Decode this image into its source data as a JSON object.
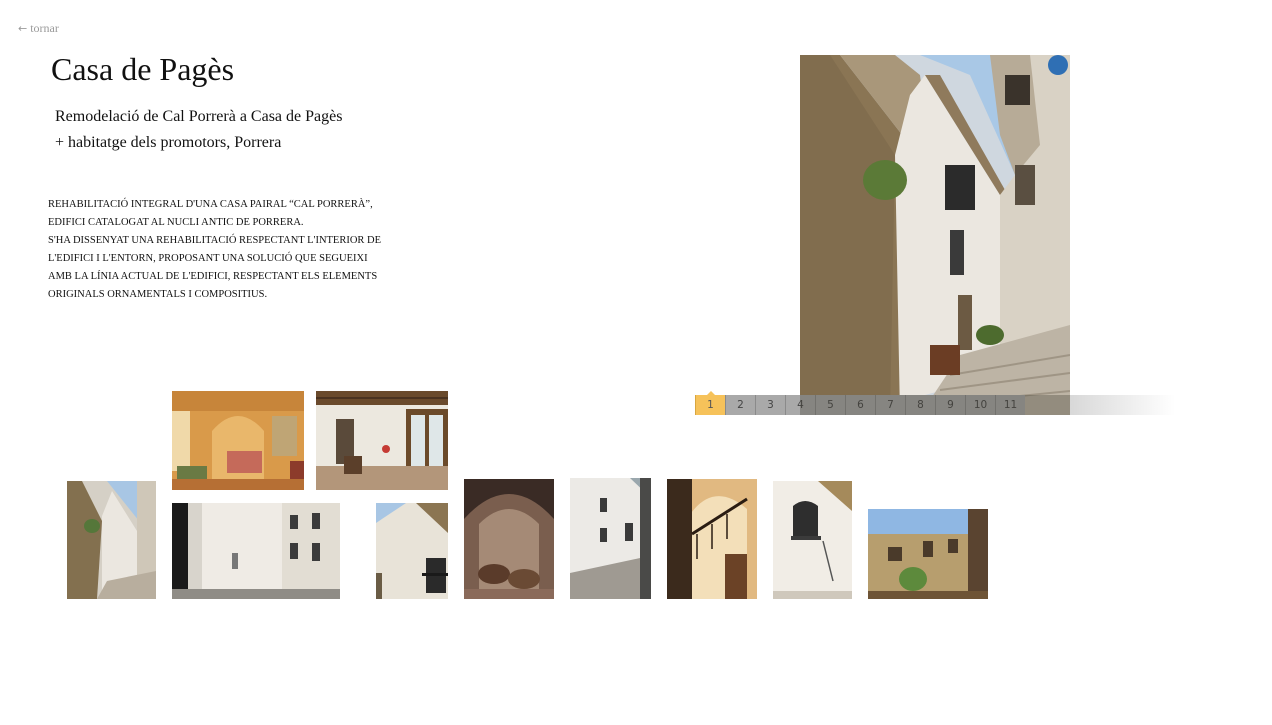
{
  "nav": {
    "back_arrow": "←",
    "back_label": "tornar"
  },
  "header": {
    "title": "Casa de Pagès"
  },
  "subtitle": {
    "line1": "Remodelació de Cal Porrerà a Casa de Pagès",
    "line2": "+ habitatge dels promotors, Porrera"
  },
  "description": {
    "lines": [
      "REHABILITACIÓ INTEGRAL D'UNA CASA PAIRAL “CAL PORRERÀ”,",
      "EDIFICI CATALOGAT AL NUCLI ANTIC DE PORRERA.",
      "S'HA DISSENYAT UNA REHABILITACIÓ RESPECTANT L'INTERIOR DE",
      "L'EDIFICI I L'ENTORN, PROPOSANT UNA SOLUCIÓ QUE SEGUEIXI",
      "AMB LA LÍNIA ACTUAL DE L'EDIFICI, RESPECTANT ELS ELEMENTS",
      "ORIGINALS ORNAMENTALS I COMPOSITIUS."
    ]
  },
  "pager": {
    "pages": [
      "1",
      "2",
      "3",
      "4",
      "5",
      "6",
      "7",
      "8",
      "9",
      "10",
      "11"
    ],
    "active": "1"
  },
  "colors": {
    "accent": "#f6c25a",
    "pager_gray": "#a9a9a9",
    "link_gray": "#9a9a9a"
  }
}
